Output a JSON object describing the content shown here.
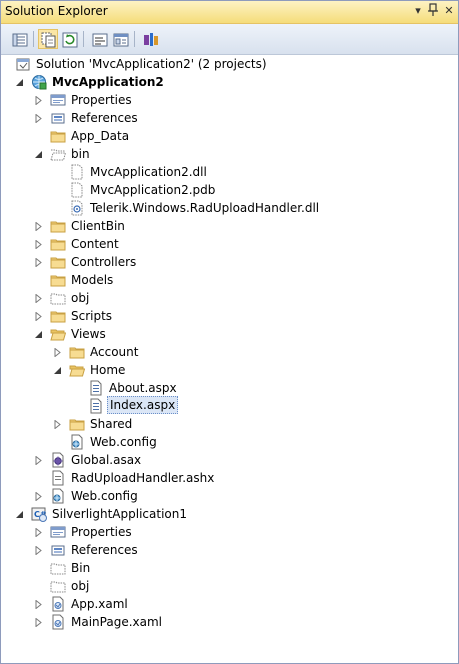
{
  "window": {
    "title": "Solution Explorer",
    "dropdown_glyph": "▾",
    "pin_glyph": "ᐯ",
    "close_glyph": "✕"
  },
  "toolbar": {
    "buttons": [
      {
        "name": "properties-toolbar-button",
        "icon": "properties-icon"
      },
      {
        "name": "show-all-files-toolbar-button",
        "icon": "show-all-files-icon",
        "active": true
      },
      {
        "name": "refresh-toolbar-button",
        "icon": "refresh-icon"
      },
      {
        "name": "view-code-toolbar-button",
        "icon": "view-code-icon"
      },
      {
        "name": "view-designer-toolbar-button",
        "icon": "view-designer-icon"
      },
      {
        "name": "class-diagram-toolbar-button",
        "icon": "class-diagram-icon"
      }
    ]
  },
  "tree": [
    {
      "label": "Solution 'MvcApplication2' (2 projects)",
      "level": 0,
      "expander": "none",
      "icon": "solution-icon"
    },
    {
      "label": "MvcApplication2",
      "level": 0,
      "expander": "expanded",
      "icon": "web-project-icon",
      "bold": true
    },
    {
      "label": "Properties",
      "level": 1,
      "expander": "collapsed",
      "icon": "properties-icon"
    },
    {
      "label": "References",
      "level": 1,
      "expander": "collapsed",
      "icon": "references-icon"
    },
    {
      "label": "App_Data",
      "level": 1,
      "expander": "none",
      "icon": "folder-icon"
    },
    {
      "label": "bin",
      "level": 1,
      "expander": "expanded",
      "icon": "folder-open-dashed-icon"
    },
    {
      "label": "MvcApplication2.dll",
      "level": 2,
      "expander": "none",
      "icon": "file-dashed-icon"
    },
    {
      "label": "MvcApplication2.pdb",
      "level": 2,
      "expander": "none",
      "icon": "file-dashed-icon"
    },
    {
      "label": "Telerik.Windows.RadUploadHandler.dll",
      "level": 2,
      "expander": "none",
      "icon": "dll-file-icon"
    },
    {
      "label": "ClientBin",
      "level": 1,
      "expander": "collapsed",
      "icon": "folder-icon"
    },
    {
      "label": "Content",
      "level": 1,
      "expander": "collapsed",
      "icon": "folder-icon"
    },
    {
      "label": "Controllers",
      "level": 1,
      "expander": "collapsed",
      "icon": "folder-icon"
    },
    {
      "label": "Models",
      "level": 1,
      "expander": "none",
      "icon": "folder-icon"
    },
    {
      "label": "obj",
      "level": 1,
      "expander": "collapsed",
      "icon": "folder-dashed-icon"
    },
    {
      "label": "Scripts",
      "level": 1,
      "expander": "collapsed",
      "icon": "folder-icon"
    },
    {
      "label": "Views",
      "level": 1,
      "expander": "expanded",
      "icon": "folder-open-icon"
    },
    {
      "label": "Account",
      "level": 2,
      "expander": "collapsed",
      "icon": "folder-icon"
    },
    {
      "label": "Home",
      "level": 2,
      "expander": "expanded",
      "icon": "folder-open-icon"
    },
    {
      "label": "About.aspx",
      "level": 3,
      "expander": "none",
      "icon": "aspx-file-icon"
    },
    {
      "label": "Index.aspx",
      "level": 3,
      "expander": "none",
      "icon": "aspx-file-icon",
      "selected": true
    },
    {
      "label": "Shared",
      "level": 2,
      "expander": "collapsed",
      "icon": "folder-icon"
    },
    {
      "label": "Web.config",
      "level": 2,
      "expander": "none",
      "icon": "config-file-icon"
    },
    {
      "label": "Global.asax",
      "level": 1,
      "expander": "collapsed",
      "icon": "global-asax-icon"
    },
    {
      "label": "RadUploadHandler.ashx",
      "level": 1,
      "expander": "none",
      "icon": "ashx-file-icon"
    },
    {
      "label": "Web.config",
      "level": 1,
      "expander": "collapsed",
      "icon": "config-file-icon"
    },
    {
      "label": "SilverlightApplication1",
      "level": 0,
      "expander": "expanded",
      "icon": "silverlight-project-icon"
    },
    {
      "label": "Properties",
      "level": 1,
      "expander": "collapsed",
      "icon": "properties-icon"
    },
    {
      "label": "References",
      "level": 1,
      "expander": "collapsed",
      "icon": "references-icon"
    },
    {
      "label": "Bin",
      "level": 1,
      "expander": "none",
      "icon": "folder-dashed-icon"
    },
    {
      "label": "obj",
      "level": 1,
      "expander": "none",
      "icon": "folder-dashed-icon"
    },
    {
      "label": "App.xaml",
      "level": 1,
      "expander": "collapsed",
      "icon": "xaml-file-icon"
    },
    {
      "label": "MainPage.xaml",
      "level": 1,
      "expander": "collapsed",
      "icon": "xaml-file-icon"
    }
  ]
}
